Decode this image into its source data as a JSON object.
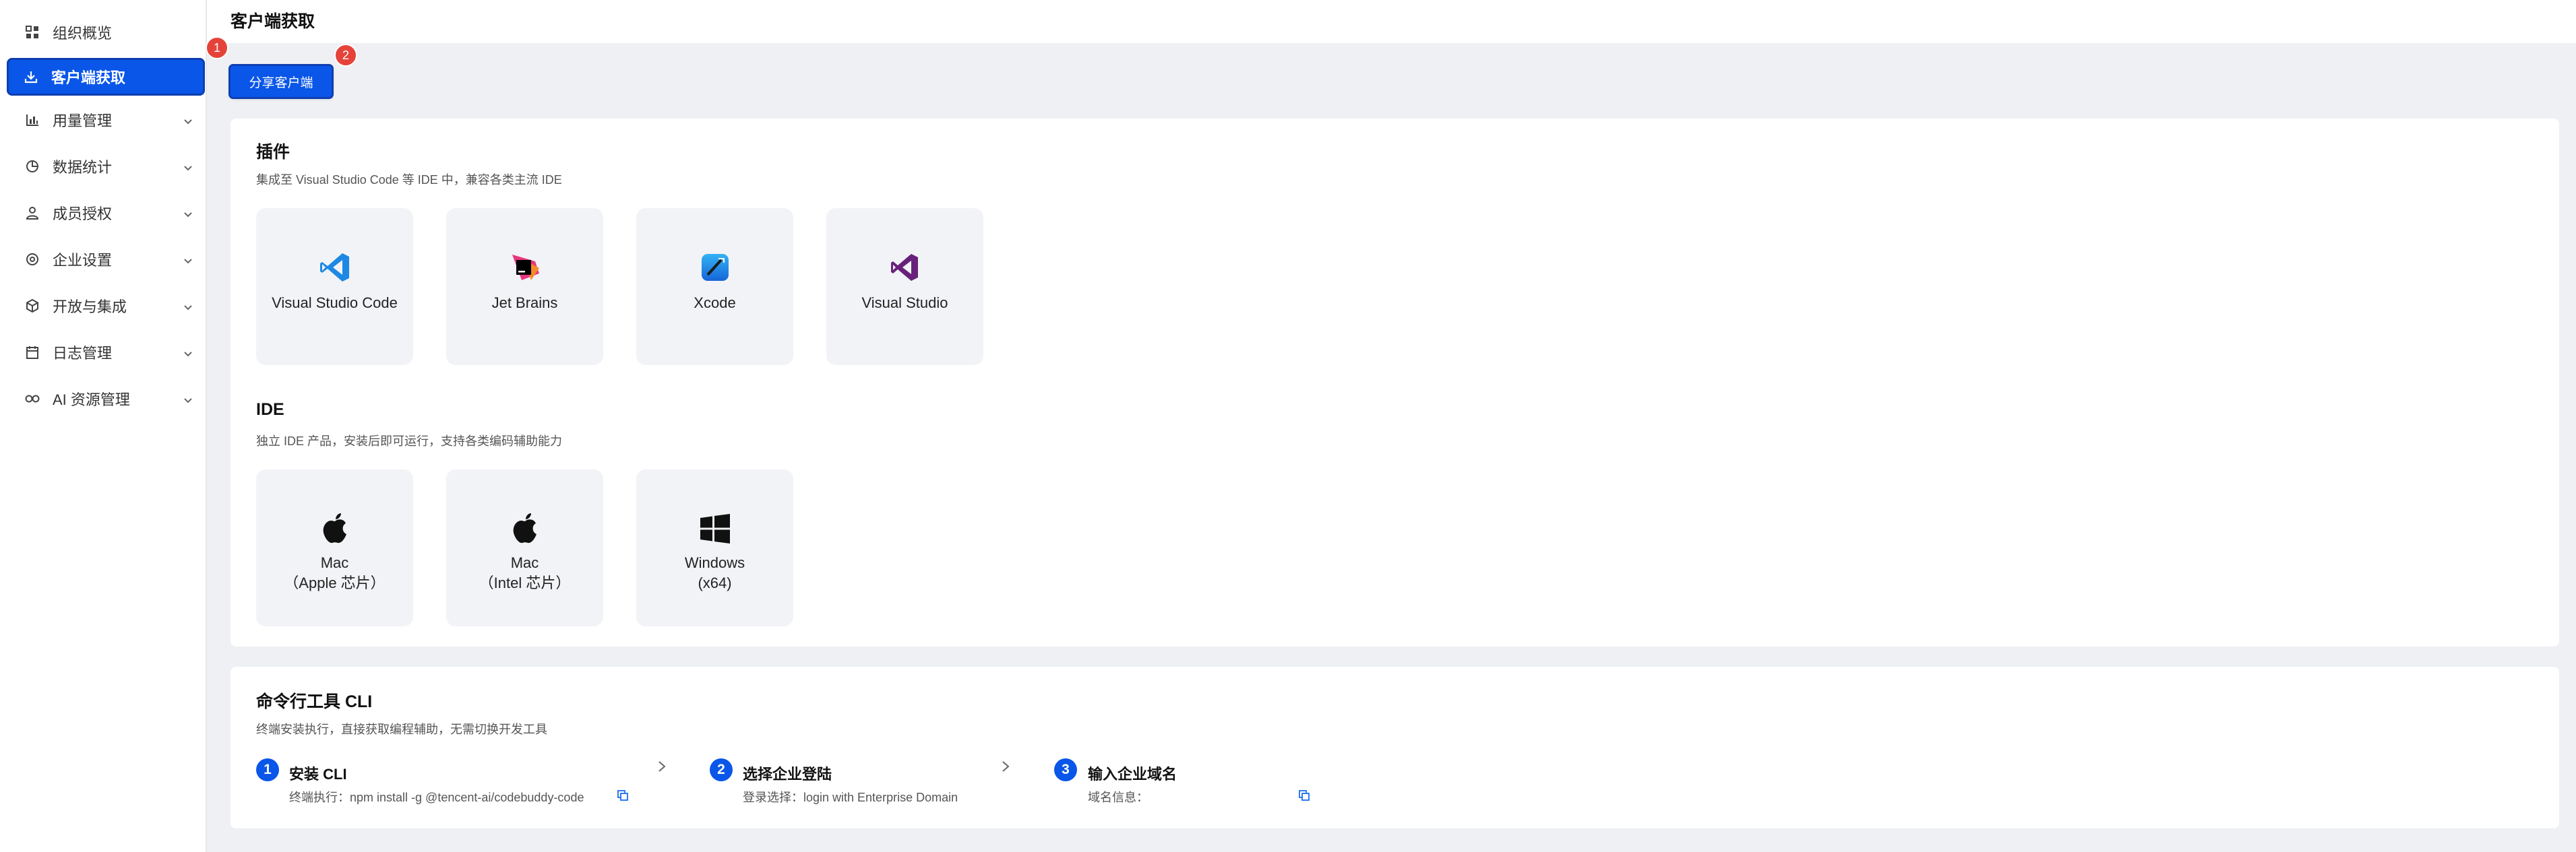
{
  "sidebar": {
    "items": [
      {
        "label": "组织概览",
        "icon": "grid-icon",
        "expandable": false
      },
      {
        "label": "客户端获取",
        "icon": "download-icon",
        "expandable": false,
        "active": true
      },
      {
        "label": "用量管理",
        "icon": "bar-chart-icon",
        "expandable": true
      },
      {
        "label": "数据统计",
        "icon": "pie-chart-icon",
        "expandable": true
      },
      {
        "label": "成员授权",
        "icon": "user-icon",
        "expandable": true
      },
      {
        "label": "企业设置",
        "icon": "settings-icon",
        "expandable": true
      },
      {
        "label": "开放与集成",
        "icon": "cube-icon",
        "expandable": true
      },
      {
        "label": "日志管理",
        "icon": "calendar-icon",
        "expandable": true
      },
      {
        "label": "AI 资源管理",
        "icon": "infinity-icon",
        "expandable": true
      }
    ]
  },
  "badges": {
    "one": "1",
    "two": "2"
  },
  "header": {
    "title": "客户端获取"
  },
  "share_button": "分享客户端",
  "plugins": {
    "title": "插件",
    "desc": "集成至 Visual Studio Code 等 IDE 中，兼容各类主流 IDE",
    "cards": [
      {
        "label": "Visual Studio Code",
        "icon": "vscode-icon"
      },
      {
        "label": "Jet Brains",
        "icon": "jetbrains-icon"
      },
      {
        "label": "Xcode",
        "icon": "xcode-icon"
      },
      {
        "label": "Visual Studio",
        "icon": "visual-studio-icon"
      }
    ]
  },
  "ide": {
    "title": "IDE",
    "desc": "独立 IDE 产品，安装后即可运行，支持各类编码辅助能力",
    "cards": [
      {
        "line1": "Mac",
        "line2": "（Apple 芯片）",
        "icon": "apple-icon"
      },
      {
        "line1": "Mac",
        "line2": "（Intel 芯片）",
        "icon": "apple-icon"
      },
      {
        "line1": "Windows",
        "line2": "(x64)",
        "icon": "windows-icon"
      }
    ]
  },
  "cli": {
    "title": "命令行工具 CLI",
    "desc": "终端安装执行，直接获取编程辅助，无需切换开发工具",
    "steps": [
      {
        "num": "1",
        "title": "安装 CLI",
        "desc": "终端执行：npm install -g @tencent-ai/codebuddy-code"
      },
      {
        "num": "2",
        "title": "选择企业登陆",
        "desc": "登录选择：login with Enterprise Domain"
      },
      {
        "num": "3",
        "title": "输入企业域名",
        "desc": "域名信息："
      }
    ]
  },
  "colors": {
    "primary": "#0a56e8",
    "badge": "#e5433a",
    "bg": "#eef0f4"
  }
}
